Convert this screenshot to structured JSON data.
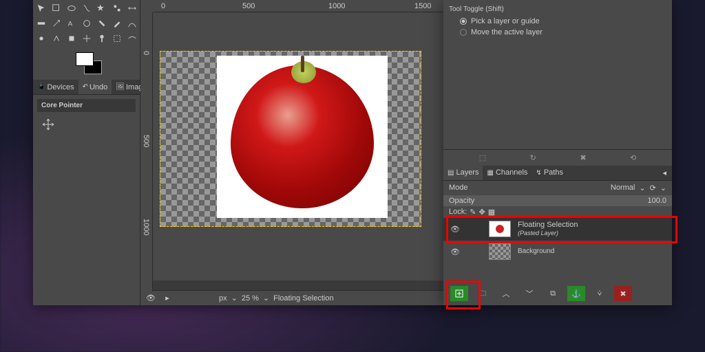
{
  "ruler_h": {
    "t1": "0",
    "t2": "500",
    "t3": "1000",
    "t4": "1500"
  },
  "ruler_v": {
    "t1": "0",
    "t2": "500",
    "t3": "1000"
  },
  "docks": {
    "devices": "Devices",
    "undo": "Undo",
    "images": "Images",
    "core_pointer": "Core Pointer"
  },
  "status": {
    "unit": "px",
    "zoom": "25 %",
    "layer": "Floating Selection"
  },
  "tool_options": {
    "title": "Tool Toggle  (Shift)",
    "opt1": "Pick a layer or guide",
    "opt2": "Move the active layer"
  },
  "layers_panel": {
    "tab_layers": "Layers",
    "tab_channels": "Channels",
    "tab_paths": "Paths",
    "mode_label": "Mode",
    "mode_value": "Normal",
    "opacity_label": "Opacity",
    "opacity_value": "100.0",
    "lock_label": "Lock:"
  },
  "layers": [
    {
      "name": "Floating Selection",
      "sub": "(Pasted Layer)"
    },
    {
      "name": "Background"
    }
  ]
}
